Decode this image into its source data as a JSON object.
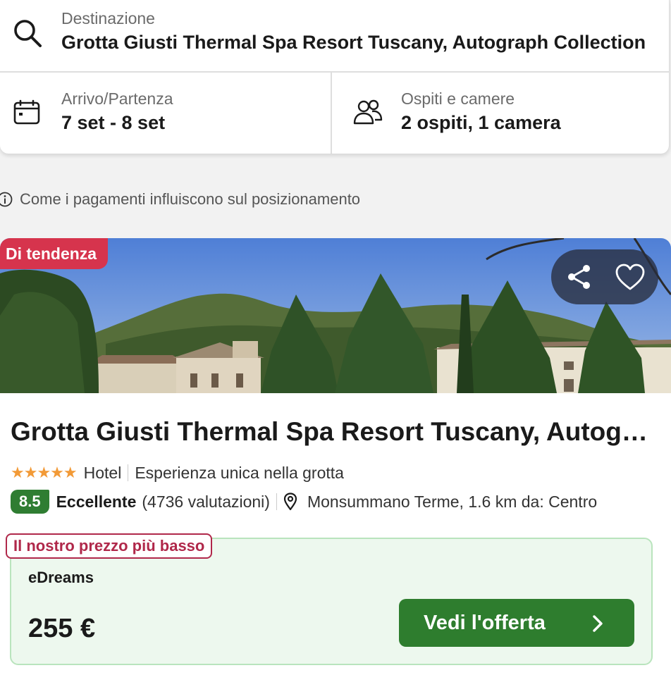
{
  "search": {
    "destination_label": "Destinazione",
    "destination_value": "Grotta Giusti Thermal Spa Resort Tuscany, Autograph Collection",
    "dates_label": "Arrivo/Partenza",
    "dates_value": "7 set - 8 set",
    "guests_label": "Ospiti e camere",
    "guests_value": "2 ospiti, 1 camera"
  },
  "info": {
    "text": "Come i pagamenti influiscono sul posizionamento",
    "icon": "info-icon"
  },
  "hotel": {
    "badge": "Di tendenza",
    "name": "Grotta Giusti Thermal Spa Resort Tuscany, Autograph Collection",
    "star_count": 5,
    "stars": "★★★★★",
    "type": "Hotel",
    "highlight": "Esperienza unica nella grotta",
    "score": "8.5",
    "score_label": "Eccellente",
    "reviews": "(4736 valutazioni)",
    "location": "Monsummano Terme, 1.6 km da: Centro",
    "actions": [
      "share-icon",
      "heart-icon"
    ]
  },
  "offer": {
    "badge": "Il nostro prezzo più basso",
    "provider": "eDreams",
    "price": "255 €",
    "cta": "Vedi l'offerta"
  },
  "colors": {
    "trend_badge": "#d6344d",
    "score_badge": "#2f7d32",
    "cta": "#2e7d2e",
    "offer_bg": "#edf8ee",
    "lowest_badge": "#b0284a",
    "stars": "#f29a37"
  }
}
